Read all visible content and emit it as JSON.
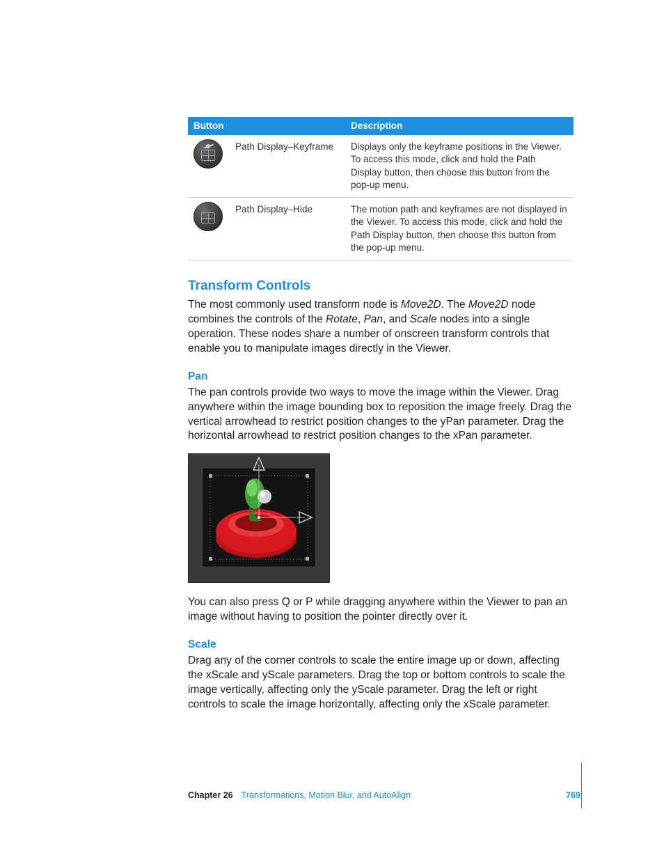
{
  "table": {
    "header_button": "Button",
    "header_desc": "Description",
    "rows": [
      {
        "name": "Path Display–Keyframe",
        "desc": "Displays only the keyframe positions in the Viewer. To access this mode, click and hold the Path Display button, then choose this button from the pop-up menu."
      },
      {
        "name": "Path Display–Hide",
        "desc": "The motion path and keyframes are not displayed in the Viewer. To access this mode, click and hold the Path Display button, then choose this button from the pop-up menu."
      }
    ]
  },
  "h_transform": "Transform Controls",
  "p_transform_1a": "The most commonly used transform node is ",
  "p_transform_1b": ". The ",
  "p_transform_1c": " node combines the controls of the ",
  "p_transform_1d": ", ",
  "p_transform_1e": ", and ",
  "p_transform_1f": " nodes into a single operation. These nodes share a number of onscreen transform controls that enable you to manipulate images directly in the Viewer.",
  "word_move2d": "Move2D",
  "word_rotate": "Rotate",
  "word_pan": "Pan",
  "word_scale": "Scale",
  "h_pan": "Pan",
  "p_pan": "The pan controls provide two ways to move the image within the Viewer. Drag anywhere within the image bounding box to reposition the image freely. Drag the vertical arrowhead to restrict position changes to the yPan parameter. Drag the horizontal arrowhead to restrict position changes to the xPan parameter.",
  "p_pan2": "You can also press Q or P while dragging anywhere within the Viewer to pan an image without having to position the pointer directly over it.",
  "h_scale": "Scale",
  "p_scale": "Drag any of the corner controls to scale the entire image up or down, affecting the xScale and yScale parameters. Drag the top or bottom controls to scale the image vertically, affecting only the yScale parameter. Drag the left or right controls to scale the image horizontally, affecting only the xScale parameter.",
  "footer": {
    "chapter_label": "Chapter 26",
    "chapter_title": "Transformations, Motion Blur, and AutoAlign",
    "page_no": "769"
  }
}
